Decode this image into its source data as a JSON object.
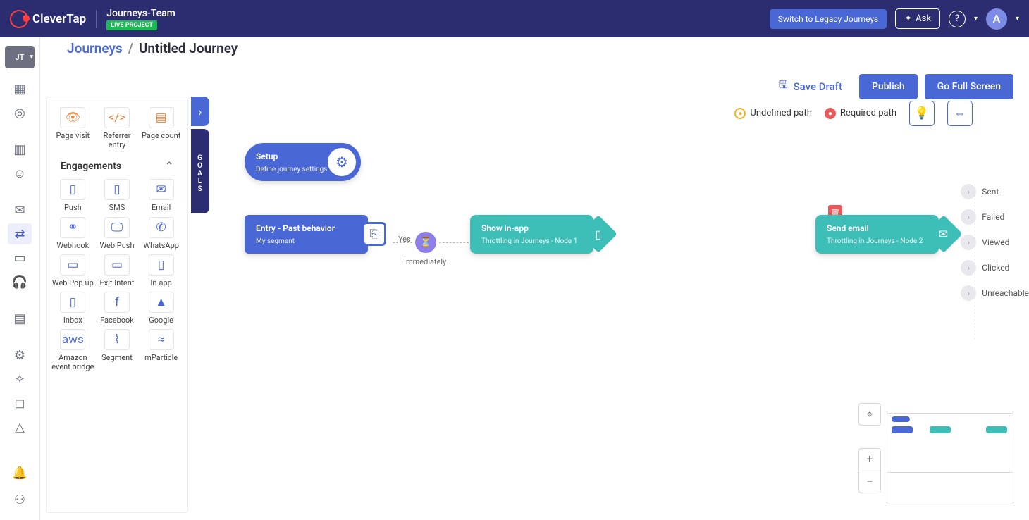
{
  "header": {
    "logo": "CleverTap",
    "project_name": "Journeys-Team",
    "project_badge": "LIVE PROJECT",
    "legacy_btn": "Switch to Legacy Journeys",
    "ask_btn": "Ask",
    "avatar_initial": "A"
  },
  "leftrail": {
    "chip": "JT"
  },
  "breadcrumb": {
    "root": "Journeys",
    "current": "Untitled Journey"
  },
  "actions": {
    "save": "Save Draft",
    "publish": "Publish",
    "fullscreen": "Go Full Screen"
  },
  "palette": {
    "top": [
      {
        "label": "Page visit"
      },
      {
        "label": "Referrer entry"
      },
      {
        "label": "Page count"
      }
    ],
    "section": "Engagements",
    "items": [
      {
        "label": "Push"
      },
      {
        "label": "SMS"
      },
      {
        "label": "Email"
      },
      {
        "label": "Webhook"
      },
      {
        "label": "Web Push"
      },
      {
        "label": "WhatsApp"
      },
      {
        "label": "Web Pop-up"
      },
      {
        "label": "Exit Intent"
      },
      {
        "label": "In-app"
      },
      {
        "label": "Inbox"
      },
      {
        "label": "Facebook"
      },
      {
        "label": "Google"
      },
      {
        "label": "Amazon event bridge"
      },
      {
        "label": "Segment"
      },
      {
        "label": "mParticle"
      }
    ]
  },
  "goals_tab": "GOALS",
  "legend": {
    "undefined": "Undefined path",
    "required": "Required path"
  },
  "nodes": {
    "setup": {
      "title": "Setup",
      "sub": "Define journey settings"
    },
    "entry": {
      "title": "Entry - Past behavior",
      "sub": "My segment"
    },
    "timer": {
      "yes": "Yes",
      "imm": "Immediately"
    },
    "inapp": {
      "title": "Show in-app",
      "sub": "Throttling in Journeys - Node 1"
    },
    "email": {
      "title": "Send email",
      "sub": "Throttling in Journeys - Node 2"
    }
  },
  "outcomes": [
    "Sent",
    "Failed",
    "Viewed",
    "Clicked",
    "Unreachable"
  ]
}
